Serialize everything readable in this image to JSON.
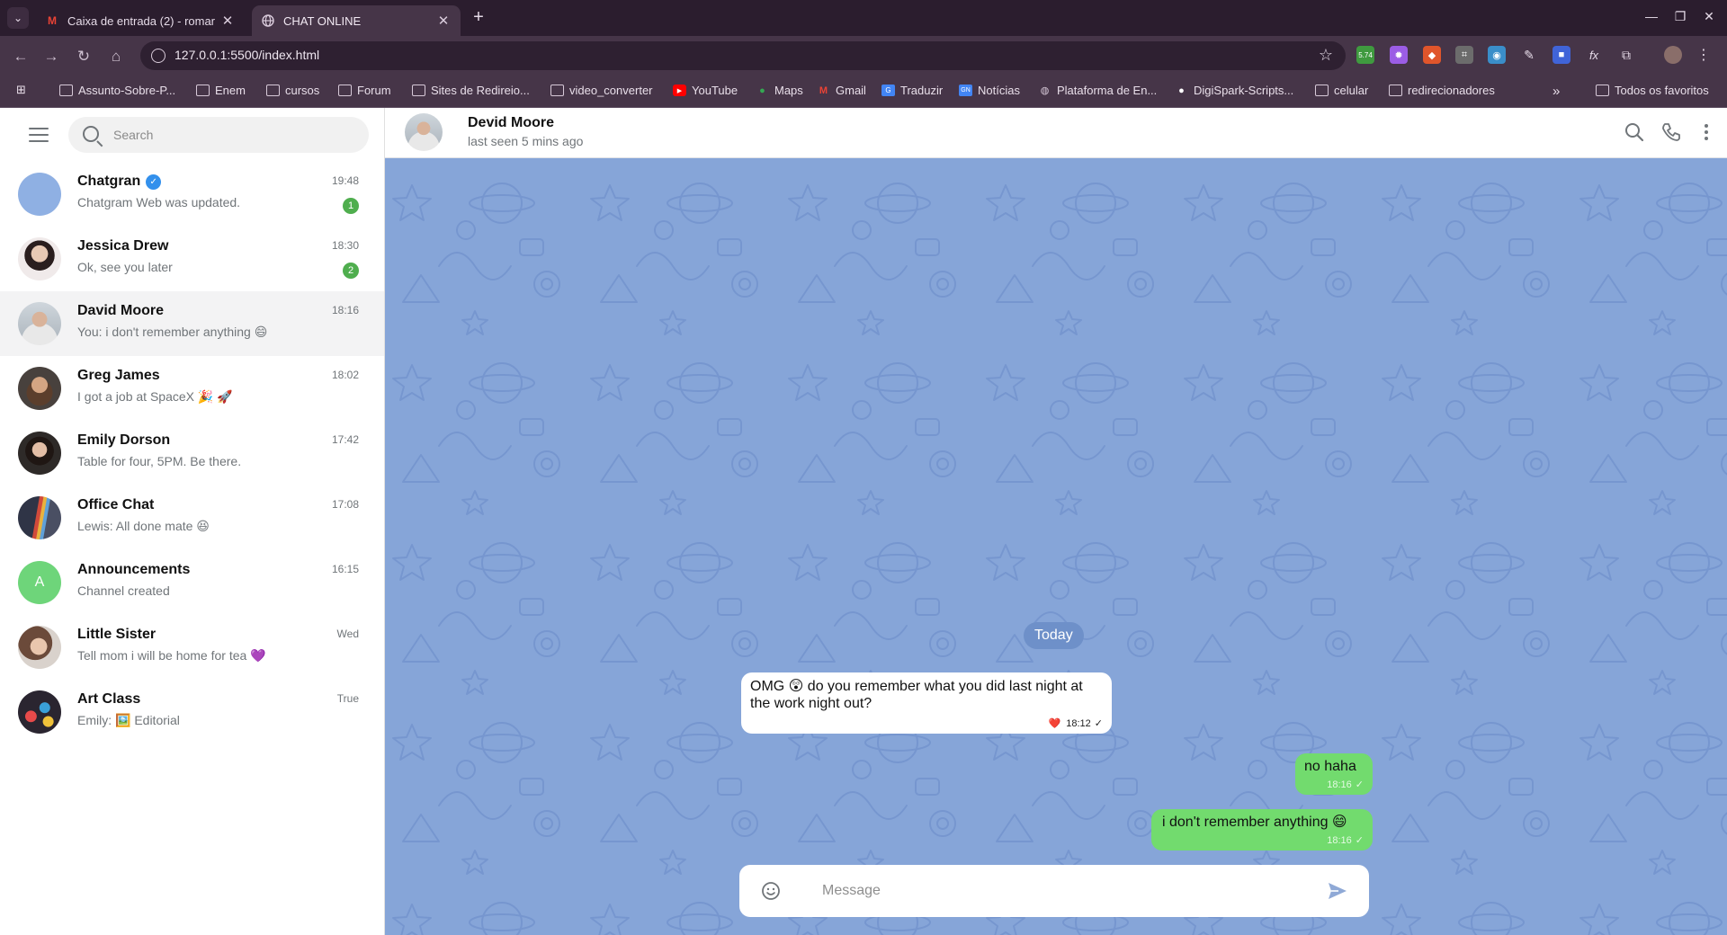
{
  "browser": {
    "tabs": [
      {
        "title": "Caixa de entrada (2) - romar",
        "favicon": "M"
      },
      {
        "title": "CHAT ONLINE"
      }
    ],
    "url": "127.0.0.1:5500/index.html",
    "extensions": [
      {
        "badge": "5.74",
        "color": "#3f9a3f"
      },
      {
        "color": "#9b5de5"
      },
      {
        "color": "#e0552b"
      },
      {
        "color": "#6c6c6c"
      },
      {
        "color": "#3a8ec9"
      },
      {
        "color": "#b9a7bb"
      },
      {
        "color": "#4064d8"
      },
      {
        "label": "fx",
        "color": "#463548"
      },
      {
        "color": "#b9a7bb"
      }
    ],
    "bookmarks": [
      {
        "label": "Assunto-Sobre-P...",
        "icon": "folder-icon"
      },
      {
        "label": "Enem",
        "icon": "folder-icon"
      },
      {
        "label": "cursos",
        "icon": "folder-icon"
      },
      {
        "label": "Forum",
        "icon": "folder-icon"
      },
      {
        "label": "Sites de Redireio...",
        "icon": "folder-icon"
      },
      {
        "label": "video_converter",
        "icon": "folder-icon"
      },
      {
        "label": "YouTube",
        "icon": "youtube-icon"
      },
      {
        "label": "Maps",
        "icon": "maps-icon"
      },
      {
        "label": "Gmail",
        "icon": "gmail-icon"
      },
      {
        "label": "Traduzir",
        "icon": "translate-icon"
      },
      {
        "label": "Notícias",
        "icon": "news-icon"
      },
      {
        "label": "Plataforma de En...",
        "icon": "globe-icon"
      },
      {
        "label": "DigiSpark-Scripts...",
        "icon": "github-icon"
      },
      {
        "label": "celular",
        "icon": "folder-icon"
      },
      {
        "label": "redirecionadores",
        "icon": "folder-icon"
      }
    ],
    "all_bookmarks_label": "Todos os favoritos"
  },
  "sidebar": {
    "search_placeholder": "Search",
    "chats": [
      {
        "name": "Chatgran",
        "preview": "Chatgram Web was updated.",
        "time": "19:48",
        "unread": "1",
        "verified": true,
        "avatar_color": "#8fb0e3"
      },
      {
        "name": "Jessica Drew",
        "preview": "Ok, see you later",
        "time": "18:30",
        "unread": "2",
        "avatar_color": "#5b4a4a"
      },
      {
        "name": "David Moore",
        "preview": "You: i don't remember anything 😄",
        "time": "18:16",
        "selected": true,
        "avatar_color": "#c9b6a3"
      },
      {
        "name": "Greg James",
        "preview": "I got a job at SpaceX 🎉 🚀",
        "time": "18:02",
        "avatar_color": "#6b5a4d"
      },
      {
        "name": "Emily Dorson",
        "preview": "Table for four, 5PM. Be there.",
        "time": "17:42",
        "avatar_color": "#3a2e2e"
      },
      {
        "name": "Office Chat",
        "preview": "Lewis: All done mate 😆",
        "time": "17:08",
        "avatar_color": "#4a4f63"
      },
      {
        "name": "Announcements",
        "preview": "Channel created",
        "time": "16:15",
        "avatar_letter": "A",
        "avatar_color": "#6ed57a"
      },
      {
        "name": "Little Sister",
        "preview": "Tell mom i will be home for tea 💜",
        "time": "Wed",
        "avatar_color": "#c9a18a"
      },
      {
        "name": "Art Class",
        "preview": "Emily: 🖼️ Editorial",
        "time": "True",
        "avatar_color": "#7a2f3a"
      }
    ]
  },
  "conversation": {
    "contact_name": "Devid Moore",
    "status": "last seen 5 mins ago",
    "day_label": "Today",
    "messages": [
      {
        "direction": "in",
        "text": "OMG 😲 do you remember what you did last night at the work night out?",
        "time": "18:12",
        "reaction": "❤️"
      },
      {
        "direction": "out",
        "text": "no haha",
        "time": "18:16"
      },
      {
        "direction": "out",
        "text": "i don't remember anything 😄",
        "time": "18:16"
      }
    ],
    "composer_placeholder": "Message"
  },
  "colors": {
    "accent_blue": "#3390ec",
    "chat_background": "#86a5d8",
    "outgoing_bubble": "#72db6e",
    "unread_badge": "#4fae4e"
  }
}
